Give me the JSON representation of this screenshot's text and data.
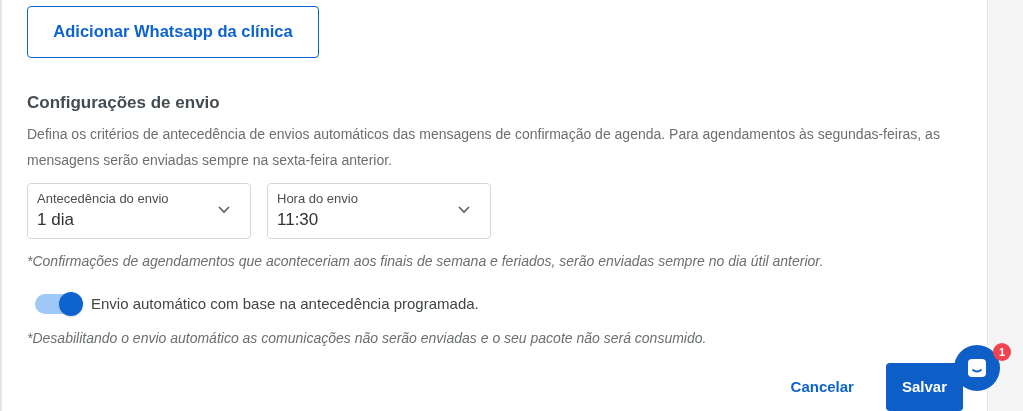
{
  "add_whatsapp_button": {
    "label": "Adicionar Whatsapp da clínica"
  },
  "section": {
    "title": "Configurações de envio",
    "description": "Defina os critérios de antecedência de envios automáticos das mensagens de confirmação de agenda. Para agendamentos às segundas-feiras, as mensagens serão enviadas sempre na sexta-feira anterior."
  },
  "selects": [
    {
      "label": "Antecedência do envio",
      "value": "1 dia"
    },
    {
      "label": "Hora do envio",
      "value": "11:30"
    }
  ],
  "weekend_note": "*Confirmações de agendamentos que aconteceriam aos finais de semana e feriados, serão enviadas sempre no dia útil anterior.",
  "auto_send": {
    "label": "Envio automático com base na antecedência programada.",
    "on": true
  },
  "disable_note": "*Desabilitando o envio automático as comunicações não serão enviadas e o seu pacote não será consumido.",
  "buttons": [
    {
      "label": "Cancelar",
      "kind": "text"
    },
    {
      "label": "Salvar",
      "kind": "primary"
    }
  ],
  "chat": {
    "badge": "1"
  }
}
